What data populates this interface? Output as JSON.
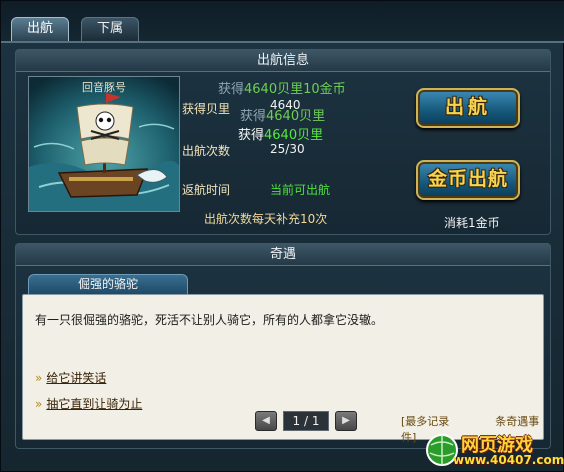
{
  "tabs": [
    {
      "label": "出航",
      "active": true
    },
    {
      "label": "下属",
      "active": false
    }
  ],
  "voyage": {
    "header": "出航信息",
    "ship_name": "回音豚号",
    "shells_label": "获得贝里",
    "shells_value": "4640",
    "count_label": "出航次数",
    "count_value": "25/30",
    "return_label": "返航时间",
    "return_value": "当前可出航",
    "refill_note": "出航次数每天补充10次",
    "float_reward_1": {
      "prefix": "获得",
      "highlight": "4640贝里10金币"
    },
    "float_reward_2": {
      "prefix": "获得",
      "highlight": "4640贝里"
    },
    "float_reward_3": {
      "prefix": "获得",
      "highlight": "4640贝里"
    },
    "sail_button": "出航",
    "gold_sail_button": "金币出航",
    "gold_cost": "消耗1金币"
  },
  "encounter": {
    "header": "奇遇",
    "subtab": "倔强的骆驼",
    "description": "有一只很倔强的骆驼，死活不让别人骑它，所有的人都拿它没辙。",
    "choices": [
      "给它讲笑话",
      "抽它直到让骑为止"
    ],
    "pager": {
      "prev": "◀",
      "page": "1 / 1",
      "next": "▶"
    },
    "more_records": "[最多记录",
    "more_records_tail": "条奇遇事件]"
  },
  "watermark": {
    "brand": "网页游戏",
    "site": "www.40407.com"
  },
  "colors": {
    "accent_gold": "#f6d651",
    "reward_green": "#4ee13c",
    "panel_bg": "#1d3341"
  }
}
